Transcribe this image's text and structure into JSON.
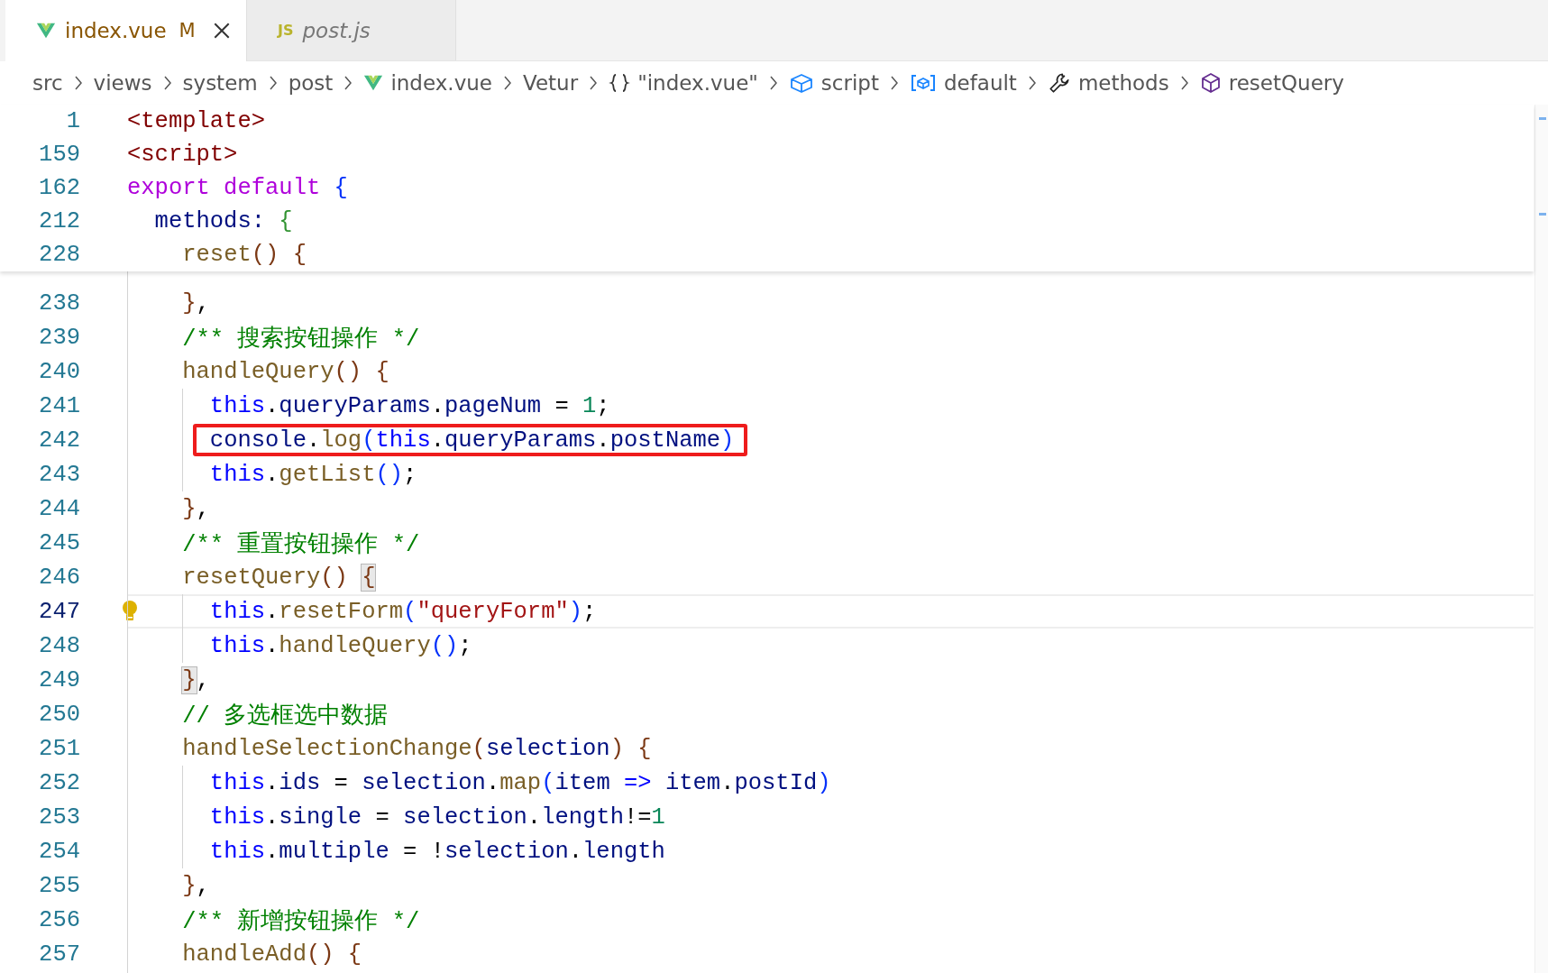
{
  "tabs": [
    {
      "label": "index.vue",
      "kind": "vue",
      "badge": "M",
      "selected": true,
      "preview": false
    },
    {
      "label": "post.js",
      "kind": "js",
      "icon_text": "JS",
      "selected": false,
      "preview": true
    }
  ],
  "breadcrumbs": [
    {
      "label": "src"
    },
    {
      "label": "views"
    },
    {
      "label": "system"
    },
    {
      "label": "post"
    },
    {
      "label": "index.vue",
      "kind": "vue"
    },
    {
      "label": "Vetur"
    },
    {
      "label": "\"index.vue\"",
      "kind": "braces"
    },
    {
      "label": "script",
      "kind": "module"
    },
    {
      "label": "default",
      "kind": "namespace"
    },
    {
      "label": "methods",
      "kind": "wrench"
    },
    {
      "label": "resetQuery",
      "kind": "method"
    }
  ],
  "sticky_lines": [
    {
      "number": "1",
      "tokens": [
        {
          "text": "<template>",
          "kind": "tag"
        }
      ]
    },
    {
      "number": "159",
      "tokens": [
        {
          "text": "<script>",
          "kind": "tag"
        }
      ]
    },
    {
      "number": "162",
      "tokens": [
        {
          "text": "export default ",
          "kind": "keyword"
        },
        {
          "text": "{",
          "kind": "b1"
        }
      ]
    },
    {
      "number": "212",
      "tokens": [
        {
          "text": "  methods: ",
          "kind": "prop"
        },
        {
          "text": "{",
          "kind": "b2"
        }
      ]
    },
    {
      "number": "228",
      "tokens": [
        {
          "text": "    reset",
          "kind": "fn"
        },
        {
          "text": "() {",
          "kind": "b3"
        }
      ]
    }
  ],
  "lines": [
    {
      "number": "238",
      "tokens": [
        {
          "text": "    }",
          "kind": "b3"
        },
        {
          "text": ",",
          "kind": "plain"
        }
      ]
    },
    {
      "number": "239",
      "tokens": [
        {
          "text": "    /** 搜索按钮操作 */",
          "kind": "comment"
        }
      ]
    },
    {
      "number": "240",
      "tokens": [
        {
          "text": "    handleQuery",
          "kind": "fn"
        },
        {
          "text": "() {",
          "kind": "b3"
        }
      ]
    },
    {
      "number": "241",
      "tokens": [
        {
          "text": "      this",
          "kind": "this"
        },
        {
          "text": ".",
          "kind": "plain"
        },
        {
          "text": "queryParams",
          "kind": "prop"
        },
        {
          "text": ".",
          "kind": "plain"
        },
        {
          "text": "pageNum",
          "kind": "prop"
        },
        {
          "text": " = ",
          "kind": "plain"
        },
        {
          "text": "1",
          "kind": "num"
        },
        {
          "text": ";",
          "kind": "plain"
        }
      ]
    },
    {
      "number": "242",
      "boxed": true,
      "tokens": [
        {
          "text": "      console",
          "kind": "prop"
        },
        {
          "text": ".",
          "kind": "plain"
        },
        {
          "text": "log",
          "kind": "fn"
        },
        {
          "text": "(",
          "kind": "b1"
        },
        {
          "text": "this",
          "kind": "this"
        },
        {
          "text": ".",
          "kind": "plain"
        },
        {
          "text": "queryParams",
          "kind": "prop"
        },
        {
          "text": ".",
          "kind": "plain"
        },
        {
          "text": "postName",
          "kind": "prop"
        },
        {
          "text": ")",
          "kind": "b1"
        }
      ]
    },
    {
      "number": "243",
      "tokens": [
        {
          "text": "      this",
          "kind": "this"
        },
        {
          "text": ".",
          "kind": "plain"
        },
        {
          "text": "getList",
          "kind": "fn"
        },
        {
          "text": "()",
          "kind": "b1"
        },
        {
          "text": ";",
          "kind": "plain"
        }
      ]
    },
    {
      "number": "244",
      "tokens": [
        {
          "text": "    }",
          "kind": "b3"
        },
        {
          "text": ",",
          "kind": "plain"
        }
      ]
    },
    {
      "number": "245",
      "tokens": [
        {
          "text": "    /** 重置按钮操作 */",
          "kind": "comment"
        }
      ]
    },
    {
      "number": "246",
      "tokens": [
        {
          "text": "    resetQuery",
          "kind": "fn"
        },
        {
          "text": "() ",
          "kind": "b3"
        },
        {
          "text": "{",
          "kind": "b3",
          "matched": true
        }
      ]
    },
    {
      "number": "247",
      "current": true,
      "lightbulb": true,
      "tokens": [
        {
          "text": "      this",
          "kind": "this"
        },
        {
          "text": ".",
          "kind": "plain"
        },
        {
          "text": "resetForm",
          "kind": "fn"
        },
        {
          "text": "(",
          "kind": "b1"
        },
        {
          "text": "\"queryForm\"",
          "kind": "str"
        },
        {
          "text": ")",
          "kind": "b1"
        },
        {
          "text": ";",
          "kind": "plain"
        }
      ]
    },
    {
      "number": "248",
      "tokens": [
        {
          "text": "      this",
          "kind": "this"
        },
        {
          "text": ".",
          "kind": "plain"
        },
        {
          "text": "handleQuery",
          "kind": "fn"
        },
        {
          "text": "()",
          "kind": "b1"
        },
        {
          "text": ";",
          "kind": "plain"
        }
      ]
    },
    {
      "number": "249",
      "tokens": [
        {
          "text": "    }",
          "kind": "b3",
          "matched": true
        },
        {
          "text": ",",
          "kind": "plain"
        }
      ]
    },
    {
      "number": "250",
      "tokens": [
        {
          "text": "    // 多选框选中数据",
          "kind": "comment"
        }
      ]
    },
    {
      "number": "251",
      "tokens": [
        {
          "text": "    handleSelectionChange",
          "kind": "fn"
        },
        {
          "text": "(",
          "kind": "b3"
        },
        {
          "text": "selection",
          "kind": "prop"
        },
        {
          "text": ") {",
          "kind": "b3"
        }
      ]
    },
    {
      "number": "252",
      "tokens": [
        {
          "text": "      this",
          "kind": "this"
        },
        {
          "text": ".",
          "kind": "plain"
        },
        {
          "text": "ids",
          "kind": "prop"
        },
        {
          "text": " = ",
          "kind": "plain"
        },
        {
          "text": "selection",
          "kind": "prop"
        },
        {
          "text": ".",
          "kind": "plain"
        },
        {
          "text": "map",
          "kind": "fn"
        },
        {
          "text": "(",
          "kind": "b1"
        },
        {
          "text": "item ",
          "kind": "prop"
        },
        {
          "text": "=> ",
          "kind": "storage"
        },
        {
          "text": "item",
          "kind": "prop"
        },
        {
          "text": ".",
          "kind": "plain"
        },
        {
          "text": "postId",
          "kind": "prop"
        },
        {
          "text": ")",
          "kind": "b1"
        }
      ]
    },
    {
      "number": "253",
      "tokens": [
        {
          "text": "      this",
          "kind": "this"
        },
        {
          "text": ".",
          "kind": "plain"
        },
        {
          "text": "single",
          "kind": "prop"
        },
        {
          "text": " = ",
          "kind": "plain"
        },
        {
          "text": "selection",
          "kind": "prop"
        },
        {
          "text": ".",
          "kind": "plain"
        },
        {
          "text": "length",
          "kind": "prop"
        },
        {
          "text": "!=",
          "kind": "plain"
        },
        {
          "text": "1",
          "kind": "num"
        }
      ]
    },
    {
      "number": "254",
      "tokens": [
        {
          "text": "      this",
          "kind": "this"
        },
        {
          "text": ".",
          "kind": "plain"
        },
        {
          "text": "multiple",
          "kind": "prop"
        },
        {
          "text": " = ",
          "kind": "plain"
        },
        {
          "text": "!",
          "kind": "plain"
        },
        {
          "text": "selection",
          "kind": "prop"
        },
        {
          "text": ".",
          "kind": "plain"
        },
        {
          "text": "length",
          "kind": "prop"
        }
      ]
    },
    {
      "number": "255",
      "tokens": [
        {
          "text": "    }",
          "kind": "b3"
        },
        {
          "text": ",",
          "kind": "plain"
        }
      ]
    },
    {
      "number": "256",
      "tokens": [
        {
          "text": "    /** 新增按钮操作 */",
          "kind": "comment"
        }
      ]
    },
    {
      "number": "257",
      "tokens": [
        {
          "text": "    handleAdd",
          "kind": "fn"
        },
        {
          "text": "() {",
          "kind": "b3"
        }
      ]
    }
  ]
}
